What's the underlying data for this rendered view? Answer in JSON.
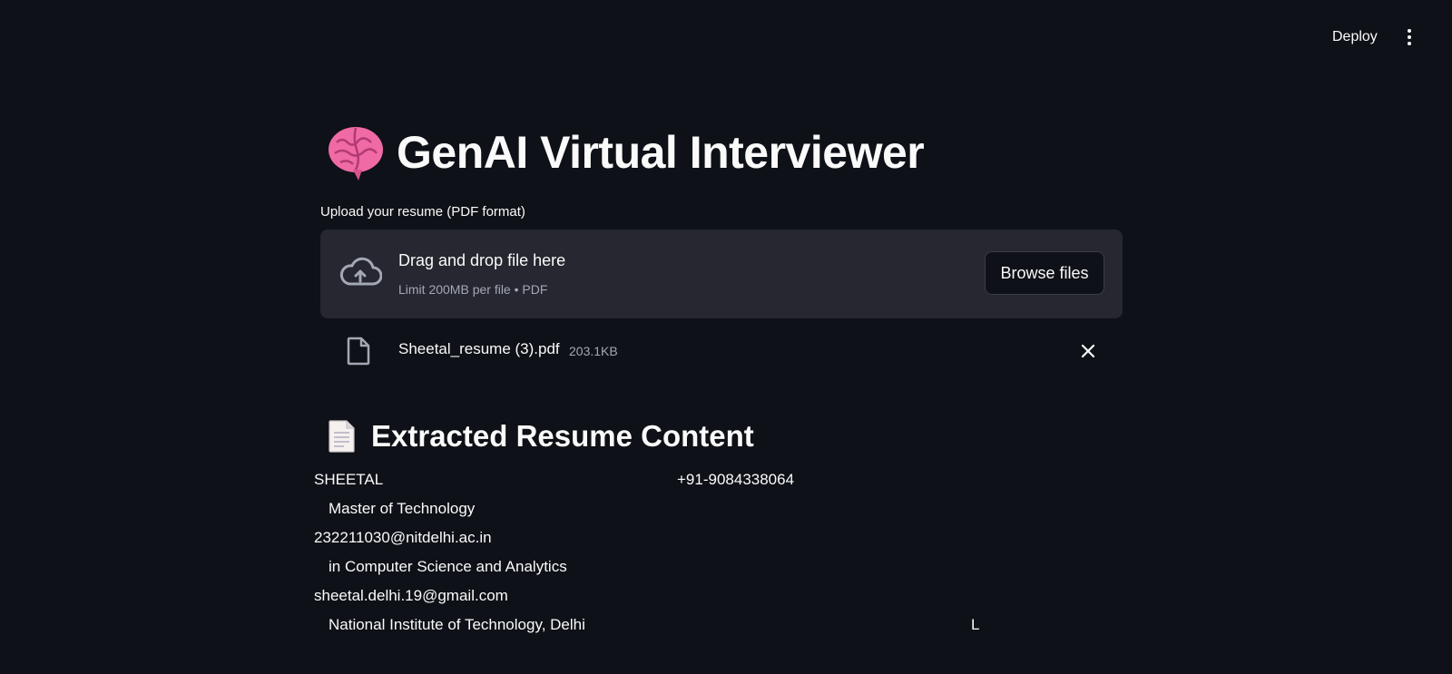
{
  "header": {
    "deploy_label": "Deploy",
    "menu_icon": "kebab-vertical-icon"
  },
  "app": {
    "title": "GenAI Virtual Interviewer",
    "title_icon": "brain-emoji-icon"
  },
  "uploader": {
    "label": "Upload your resume (PDF format)",
    "drop_text": "Drag and drop file here",
    "limit_text": "Limit 200MB per file • PDF",
    "browse_label": "Browse files",
    "icon": "cloud-upload-icon"
  },
  "uploaded_file": {
    "name": "Sheetal_resume (3).pdf",
    "size": "203.1KB",
    "icon": "file-icon",
    "remove_icon": "close-icon"
  },
  "section": {
    "title": "Extracted Resume Content",
    "icon": "page-facing-up-icon"
  },
  "resume": {
    "name": "SHEETAL",
    "phone": "+91-9084338064",
    "lines": [
      "Master of Technology",
      "232211030@nitdelhi.ac.in",
      "in Computer Science and Analytics",
      "sheetal.delhi.19@gmail.com",
      "National Institute of Technology, Delhi"
    ],
    "stray_char": "L"
  },
  "colors": {
    "background": "#0e1117",
    "surface": "#262730",
    "text": "#fafafa",
    "muted": "#a3a8b4",
    "brain_pink": "#f06aa5"
  }
}
